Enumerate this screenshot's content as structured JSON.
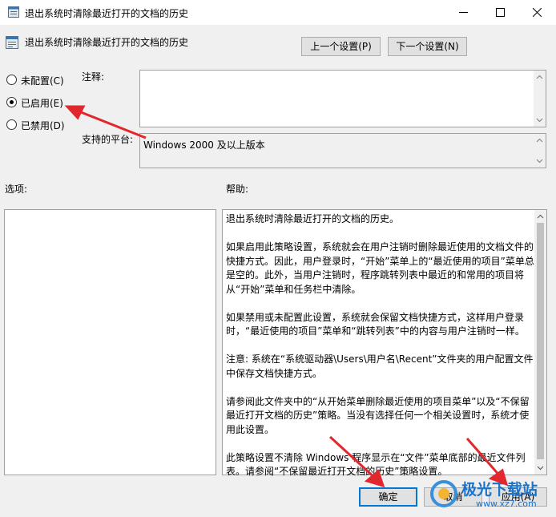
{
  "window": {
    "title": "退出系统时清除最近打开的文档的历史",
    "minimize_glyph": "minimize-icon",
    "maximize_glyph": "maximize-icon",
    "close_glyph": "close-icon"
  },
  "header": {
    "policy_name": "退出系统时清除最近打开的文档的历史",
    "prev_button": "上一个设置(P)",
    "next_button": "下一个设置(N)"
  },
  "state": {
    "options": [
      {
        "label": "未配置(C)",
        "selected": false
      },
      {
        "label": "已启用(E)",
        "selected": true
      },
      {
        "label": "已禁用(D)",
        "selected": false
      }
    ]
  },
  "comment": {
    "label": "注释:",
    "value": ""
  },
  "platform": {
    "label": "支持的平台:",
    "value": "Windows 2000 及以上版本"
  },
  "options_section": {
    "label": "选项:"
  },
  "help_section": {
    "label": "帮助:",
    "text": "退出系统时清除最近打开的文档的历史。\n\n如果启用此策略设置，系统就会在用户注销时删除最近使用的文档文件的快捷方式。因此，用户登录时，“开始”菜单上的“最近使用的项目”菜单总是空的。此外，当用户注销时，程序跳转列表中最近的和常用的项目将从“开始”菜单和任务栏中清除。\n\n如果禁用或未配置此设置，系统就会保留文档快捷方式，这样用户登录时，“最近使用的项目”菜单和“跳转列表”中的内容与用户注销时一样。\n\n注意: 系统在“系统驱动器\\Users\\用户名\\Recent”文件夹的用户配置文件中保存文档快捷方式。\n\n请参阅此文件夹中的“从开始菜单删除最近使用的项目菜单”以及“不保留最近打开文档的历史”策略。当没有选择任何一个相关设置时，系统才使用此设置。\n\n此策略设置不清除 Windows 程序显示在“文件”菜单底部的最近文件列表。请参阅“不保留最近打开文档的历史”策略设置。"
  },
  "footer": {
    "ok_button": "确定",
    "cancel_button": "取消",
    "apply_button": "应用(A)"
  },
  "watermark": {
    "text": "极光下载站",
    "url_text": "www.xz7.com"
  },
  "colors": {
    "annotation_arrow": "#e0282e",
    "default_button_border": "#0078d7"
  }
}
